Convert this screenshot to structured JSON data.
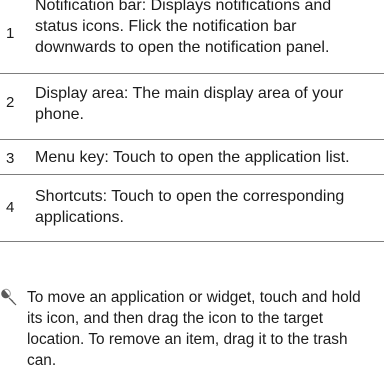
{
  "rows": [
    {
      "num": "1",
      "text": "Notification bar: Displays notifications and status icons. Flick the notification bar downwards to open the notification panel."
    },
    {
      "num": "2",
      "text": "Display area: The main display area of your phone."
    },
    {
      "num": "3",
      "text": "Menu key: Touch to open the application list."
    },
    {
      "num": "4",
      "text": "Shortcuts: Touch to open the corresponding applications."
    }
  ],
  "note": {
    "icon": "tip-icon",
    "text": "To move an application or widget, touch and hold its icon, and then drag the icon to the target location. To remove an item, drag it to the trash can."
  },
  "colors": {
    "text": "#1c1c1c",
    "rule": "#7d7d7d",
    "icon": "#5a5a5a"
  }
}
